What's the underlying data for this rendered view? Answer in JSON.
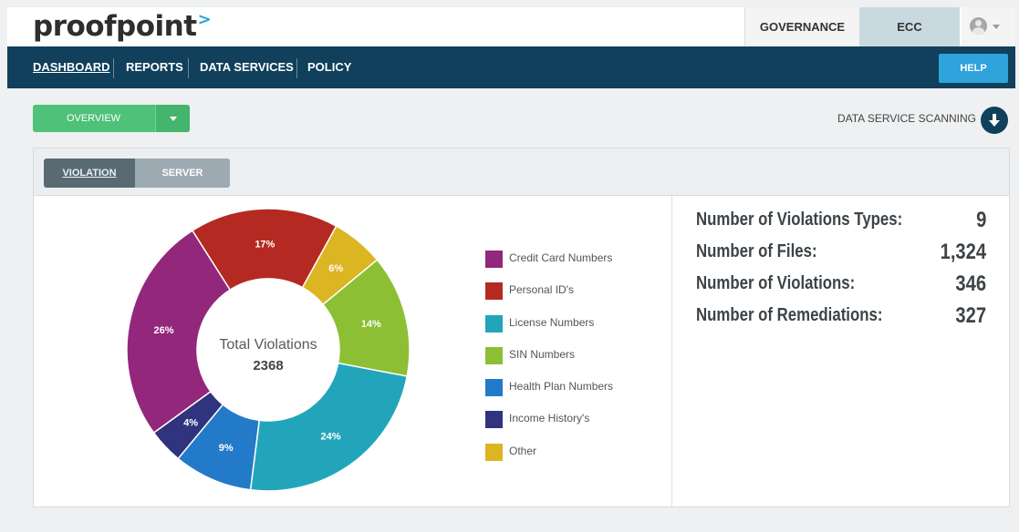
{
  "brand": {
    "logo_text": "proofpoint",
    "logo_mark": ">"
  },
  "top_tabs": {
    "governance": "GOVERNANCE",
    "ecc": "ECC"
  },
  "nav": {
    "items": [
      "DASHBOARD",
      "REPORTS",
      "DATA SERVICES",
      "POLICY"
    ],
    "help": "HELP"
  },
  "toolbar": {
    "overview_label": "OVERVIEW",
    "data_service_scanning": "DATA SERVICE SCANNING"
  },
  "panel_tabs": {
    "violation": "VIOLATION",
    "server": "SERVER"
  },
  "chart_data": {
    "type": "pie",
    "donut": true,
    "center_title": "Total Violations",
    "center_value": "2368",
    "slices": [
      {
        "name": "Credit Card Numbers",
        "label": "26%",
        "value": 26,
        "color": "#93277b"
      },
      {
        "name": "Personal ID's",
        "label": "17%",
        "value": 17,
        "color": "#b42a22"
      },
      {
        "name": "Other",
        "label": "6%",
        "value": 6,
        "color": "#dcb522"
      },
      {
        "name": "SIN Numbers",
        "label": "14%",
        "value": 14,
        "color": "#8cbf33"
      },
      {
        "name": "License Numbers",
        "label": "24%",
        "value": 24,
        "color": "#22a5bb"
      },
      {
        "name": "Health Plan Numbers",
        "label": "9%",
        "value": 9,
        "color": "#237ac8"
      },
      {
        "name": "Income History's",
        "label": "4%",
        "value": 4,
        "color": "#30337d"
      }
    ],
    "legend": [
      {
        "label": "Credit Card Numbers",
        "color": "#93277b"
      },
      {
        "label": "Personal ID's",
        "color": "#b42a22"
      },
      {
        "label": "License Numbers",
        "color": "#22a5bb"
      },
      {
        "label": "SIN Numbers",
        "color": "#8cbf33"
      },
      {
        "label": "Health Plan Numbers",
        "color": "#237ac8"
      },
      {
        "label": "Income History's",
        "color": "#30337d"
      },
      {
        "label": "Other",
        "color": "#dcb522"
      }
    ]
  },
  "stats": [
    {
      "label": "Number of Violations Types:",
      "value": "9"
    },
    {
      "label": "Number of Files:",
      "value": "1,324"
    },
    {
      "label": "Number of Violations:",
      "value": "346"
    },
    {
      "label": "Number of Remediations:",
      "value": "327"
    }
  ],
  "icons": {
    "user": "user-avatar-icon",
    "user_menu": "chevron-down-icon",
    "overview_menu": "caret-down-icon",
    "scan": "download-arrow-icon"
  }
}
